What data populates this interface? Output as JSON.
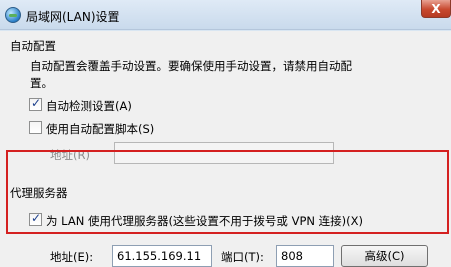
{
  "window": {
    "title": "局域网(LAN)设置",
    "close_label": "X"
  },
  "auto_config": {
    "heading": "自动配置",
    "description": "自动配置会覆盖手动设置。要确保使用手动设置，请禁用自动配置。",
    "auto_detect_label": "自动检测设置(A)",
    "auto_detect_checked": true,
    "use_script_label": "使用自动配置脚本(S)",
    "use_script_checked": false,
    "address_label": "地址(R)",
    "address_value": ""
  },
  "proxy": {
    "heading": "代理服务器",
    "use_proxy_label": "为 LAN 使用代理服务器(这些设置不用于拨号或 VPN 连接)(X)",
    "use_proxy_checked": true,
    "address_label": "地址(E):",
    "address_value": "61.155.169.11",
    "port_label": "端口(T):",
    "port_value": "808",
    "advanced_label": "高级(C)"
  }
}
